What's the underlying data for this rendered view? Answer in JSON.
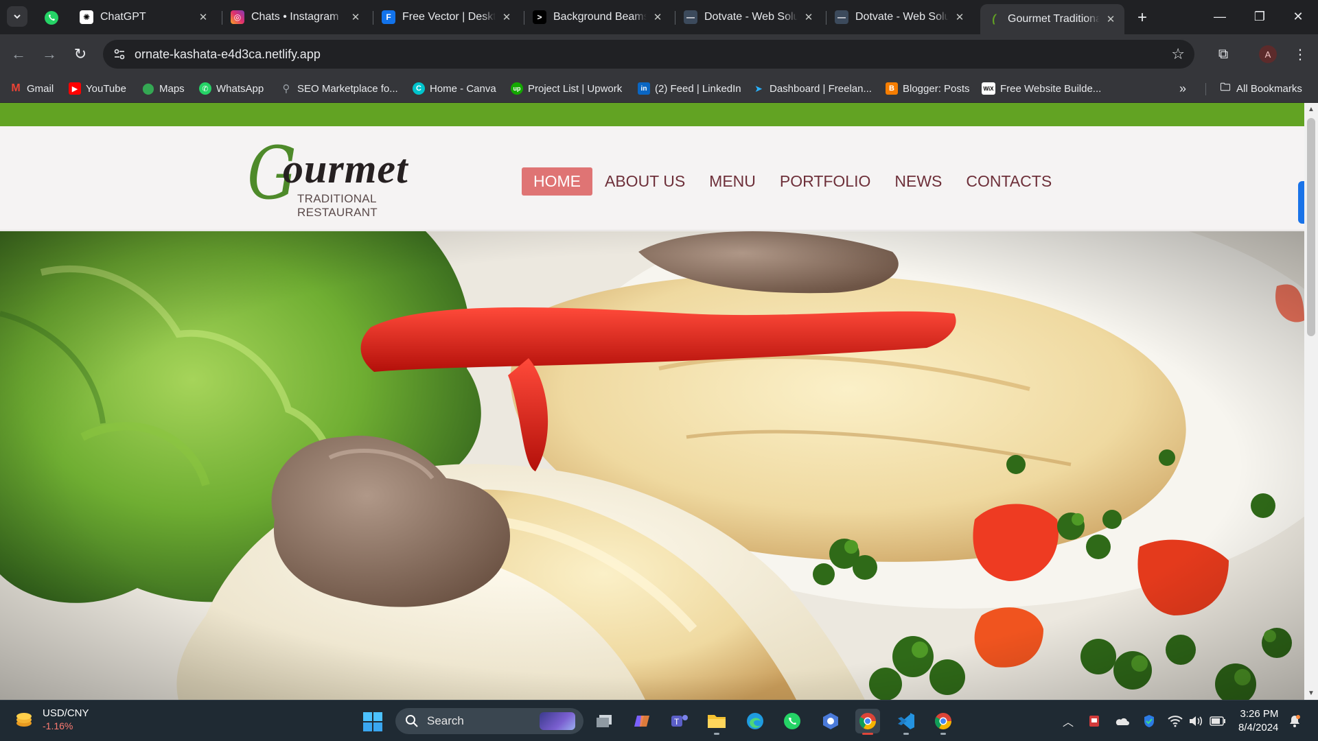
{
  "browser": {
    "tabs": [
      {
        "title": "ChatGPT",
        "icon": "chatgpt-icon"
      },
      {
        "title": "Chats • Instagram",
        "icon": "instagram-icon"
      },
      {
        "title": "Free Vector | Desktop",
        "icon": "freepik-icon"
      },
      {
        "title": "Background Beams",
        "icon": "beams-icon"
      },
      {
        "title": "Dotvate - Web Solu",
        "icon": "dotvate-icon"
      },
      {
        "title": "Dotvate - Web Solu",
        "icon": "dotvate-icon"
      },
      {
        "title": "Gourmet Traditional",
        "icon": "gourmet-icon",
        "active": true
      }
    ],
    "url": "ornate-kashata-e4d3ca.netlify.app",
    "profile_initial": "A",
    "bookmarks": [
      {
        "label": "Gmail",
        "icon": "gmail-icon"
      },
      {
        "label": "YouTube",
        "icon": "youtube-icon"
      },
      {
        "label": "Maps",
        "icon": "maps-icon"
      },
      {
        "label": "WhatsApp",
        "icon": "whatsapp-icon"
      },
      {
        "label": "SEO Marketplace fo...",
        "icon": "seo-icon"
      },
      {
        "label": "Home - Canva",
        "icon": "canva-icon"
      },
      {
        "label": "Project List | Upwork",
        "icon": "upwork-icon"
      },
      {
        "label": "(2) Feed | LinkedIn",
        "icon": "linkedin-icon"
      },
      {
        "label": "Dashboard | Freelan...",
        "icon": "freelancer-icon"
      },
      {
        "label": "Blogger: Posts",
        "icon": "blogger-icon"
      },
      {
        "label": "Free Website Builde...",
        "icon": "wix-icon"
      }
    ],
    "all_bookmarks_label": "All Bookmarks"
  },
  "site": {
    "logo_word": "ourmet",
    "logo_letter": "G",
    "logo_subtitle": "TRADITIONAL RESTAURANT",
    "nav": [
      {
        "label": "HOME",
        "active": true
      },
      {
        "label": "ABOUT US"
      },
      {
        "label": "MENU"
      },
      {
        "label": "PORTFOLIO"
      },
      {
        "label": "NEWS"
      },
      {
        "label": "CONTACTS"
      }
    ],
    "colors": {
      "top_bar": "#62a323",
      "nav_text": "#6d2f39",
      "nav_active_bg": "#df7474"
    }
  },
  "taskbar": {
    "widget_pair": "USD/CNY",
    "widget_change": "-1.16%",
    "search_label": "Search",
    "time": "3:26 PM",
    "date": "8/4/2024"
  }
}
